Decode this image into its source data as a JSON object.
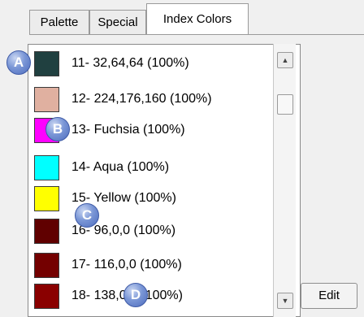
{
  "tabs": [
    {
      "label": "Palette"
    },
    {
      "label": "Special"
    },
    {
      "label": "Index Colors"
    }
  ],
  "list": {
    "items": [
      {
        "label": "11- 32,64,64 (100%)",
        "color": "#204040"
      },
      {
        "label": "12- 224,176,160 (100%)",
        "color": "#e0b0a0"
      },
      {
        "label": "13- Fuchsia (100%)",
        "color": "#ff00ff"
      },
      {
        "label": "14- Aqua (100%)",
        "color": "#00ffff"
      },
      {
        "label": "15- Yellow (100%)",
        "color": "#ffff00"
      },
      {
        "label": "16- 96,0,0 (100%)",
        "color": "#600000"
      },
      {
        "label": "17- 116,0,0 (100%)",
        "color": "#740000"
      },
      {
        "label": "18- 138,0,0 (100%)",
        "color": "#8a0000"
      }
    ]
  },
  "scrollbar": {
    "up_icon": "arrow-up-icon",
    "down_icon": "arrow-down-icon"
  },
  "edit_button": {
    "label": "Edit"
  },
  "markers": [
    {
      "label": "A"
    },
    {
      "label": "B"
    },
    {
      "label": "C"
    },
    {
      "label": "D"
    }
  ]
}
